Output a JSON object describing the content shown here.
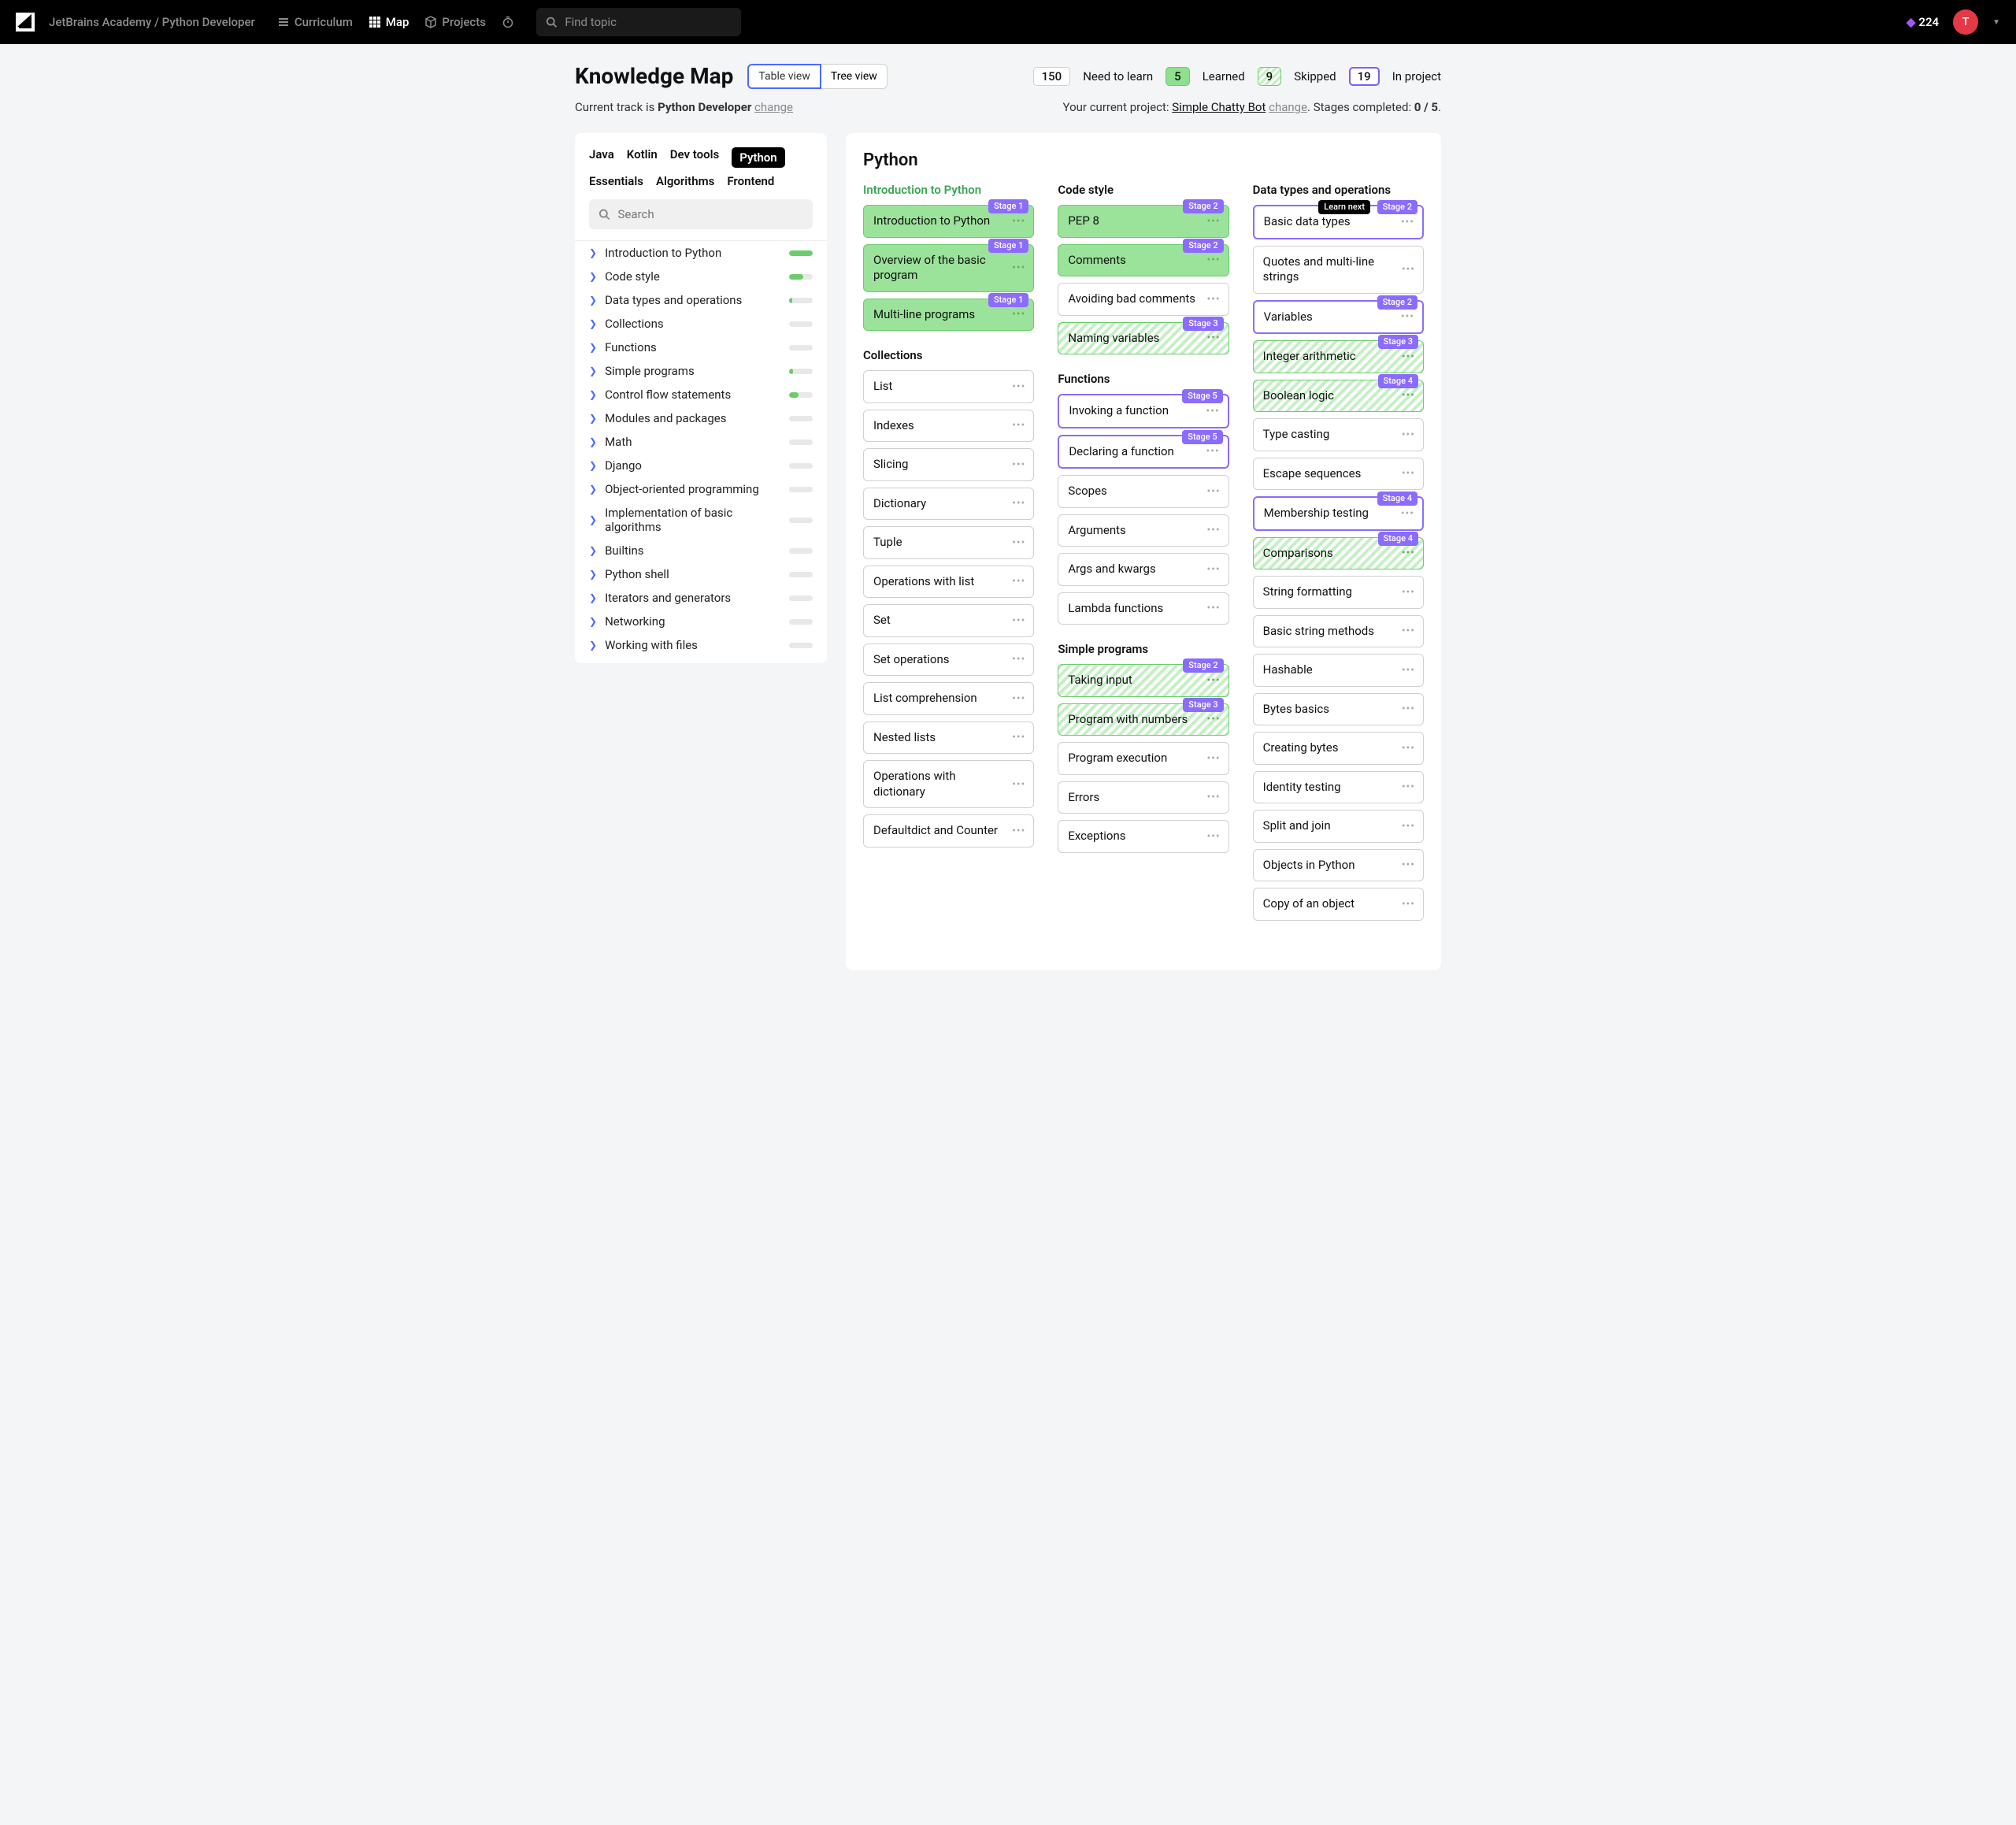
{
  "topbar": {
    "breadcrumb": "JetBrains Academy / Python Developer",
    "nav": {
      "curriculum": "Curriculum",
      "map": "Map",
      "projects": "Projects"
    },
    "search_placeholder": "Find topic",
    "gems": "224",
    "avatar": "T"
  },
  "header": {
    "title": "Knowledge Map",
    "toggle": {
      "table": "Table view",
      "tree": "Tree view"
    },
    "legend": [
      {
        "num": "150",
        "label": "Need to learn",
        "cls": ""
      },
      {
        "num": "5",
        "label": "Learned",
        "cls": "green"
      },
      {
        "num": "9",
        "label": "Skipped",
        "cls": "hatch"
      },
      {
        "num": "19",
        "label": "In project",
        "cls": "purple"
      }
    ],
    "sub_left_1": "Current track is ",
    "sub_left_2": "Python Developer",
    "sub_left_3": "change",
    "sub_right_1": "Your current project: ",
    "sub_right_2": "Simple Chatty Bot",
    "sub_right_3": "change",
    "sub_right_4": ". Stages completed: ",
    "sub_right_5": "0 / 5",
    "sub_right_6": "."
  },
  "sidebar": {
    "tabs": [
      "Java",
      "Kotlin",
      "Dev tools",
      "Python",
      "Essentials",
      "Algorithms",
      "Frontend"
    ],
    "active_tab": "Python",
    "search_placeholder": "Search",
    "items": [
      {
        "label": "Introduction to Python",
        "p": 100
      },
      {
        "label": "Code style",
        "p": 60
      },
      {
        "label": "Data types and operations",
        "p": 12
      },
      {
        "label": "Collections",
        "p": 0
      },
      {
        "label": "Functions",
        "p": 0
      },
      {
        "label": "Simple programs",
        "p": 15
      },
      {
        "label": "Control flow statements",
        "p": 40
      },
      {
        "label": "Modules and packages",
        "p": 0
      },
      {
        "label": "Math",
        "p": 0
      },
      {
        "label": "Django",
        "p": 0
      },
      {
        "label": "Object-oriented programming",
        "p": 0
      },
      {
        "label": "Implementation of basic algorithms",
        "p": 0
      },
      {
        "label": "Builtins",
        "p": 0
      },
      {
        "label": "Python shell",
        "p": 0
      },
      {
        "label": "Iterators and generators",
        "p": 0
      },
      {
        "label": "Networking",
        "p": 0
      },
      {
        "label": "Working with files",
        "p": 0
      }
    ]
  },
  "content": {
    "title": "Python",
    "columns": [
      {
        "sections": [
          {
            "title": "Introduction to Python",
            "green": true,
            "nodes": [
              {
                "t": "Introduction to Python",
                "s": "learned",
                "stage": "Stage 1"
              },
              {
                "t": "Overview of the basic program",
                "s": "learned",
                "stage": "Stage 1"
              },
              {
                "t": "Multi-line programs",
                "s": "learned",
                "stage": "Stage 1"
              }
            ]
          },
          {
            "title": "Collections",
            "nodes": [
              {
                "t": "List"
              },
              {
                "t": "Indexes"
              },
              {
                "t": "Slicing"
              },
              {
                "t": "Dictionary"
              },
              {
                "t": "Tuple"
              },
              {
                "t": "Operations with list"
              },
              {
                "t": "Set"
              },
              {
                "t": "Set operations"
              },
              {
                "t": "List comprehension"
              },
              {
                "t": "Nested lists"
              },
              {
                "t": "Operations with dictionary"
              },
              {
                "t": "Defaultdict and Counter"
              }
            ]
          }
        ]
      },
      {
        "sections": [
          {
            "title": "Code style",
            "nodes": [
              {
                "t": "PEP 8",
                "s": "learned",
                "stage": "Stage 2"
              },
              {
                "t": "Comments",
                "s": "learned",
                "stage": "Stage 2"
              },
              {
                "t": "Avoiding bad comments"
              },
              {
                "t": "Naming variables",
                "s": "skip",
                "stage": "Stage 3"
              }
            ]
          },
          {
            "title": "Functions",
            "nodes": [
              {
                "t": "Invoking a function",
                "s": "proj",
                "stage": "Stage 5"
              },
              {
                "t": "Declaring a function",
                "s": "proj",
                "stage": "Stage 5"
              },
              {
                "t": "Scopes"
              },
              {
                "t": "Arguments"
              },
              {
                "t": "Args and kwargs"
              },
              {
                "t": "Lambda functions"
              }
            ]
          },
          {
            "title": "Simple programs",
            "nodes": [
              {
                "t": "Taking input",
                "s": "skip",
                "stage": "Stage 2"
              },
              {
                "t": "Program with numbers",
                "s": "skip",
                "stage": "Stage 3"
              },
              {
                "t": "Program execution"
              },
              {
                "t": "Errors"
              },
              {
                "t": "Exceptions"
              }
            ]
          }
        ]
      },
      {
        "sections": [
          {
            "title": "Data types and operations",
            "nodes": [
              {
                "t": "Basic data types",
                "s": "proj",
                "stage": "Stage 2",
                "learn_next": "Learn next"
              },
              {
                "t": "Quotes and multi-line strings"
              },
              {
                "t": "Variables",
                "s": "proj",
                "stage": "Stage 2"
              },
              {
                "t": "Integer arithmetic",
                "s": "skip",
                "stage": "Stage 3"
              },
              {
                "t": "Boolean logic",
                "s": "skip",
                "stage": "Stage 4"
              },
              {
                "t": "Type casting"
              },
              {
                "t": "Escape sequences"
              },
              {
                "t": "Membership testing",
                "s": "proj",
                "stage": "Stage 4"
              },
              {
                "t": "Comparisons",
                "s": "skip",
                "stage": "Stage 4"
              },
              {
                "t": "String formatting"
              },
              {
                "t": "Basic string methods"
              },
              {
                "t": "Hashable"
              },
              {
                "t": "Bytes basics"
              },
              {
                "t": "Creating bytes"
              },
              {
                "t": "Identity testing"
              },
              {
                "t": "Split and join"
              },
              {
                "t": "Objects in Python"
              },
              {
                "t": "Copy of an object"
              }
            ]
          }
        ]
      }
    ]
  }
}
